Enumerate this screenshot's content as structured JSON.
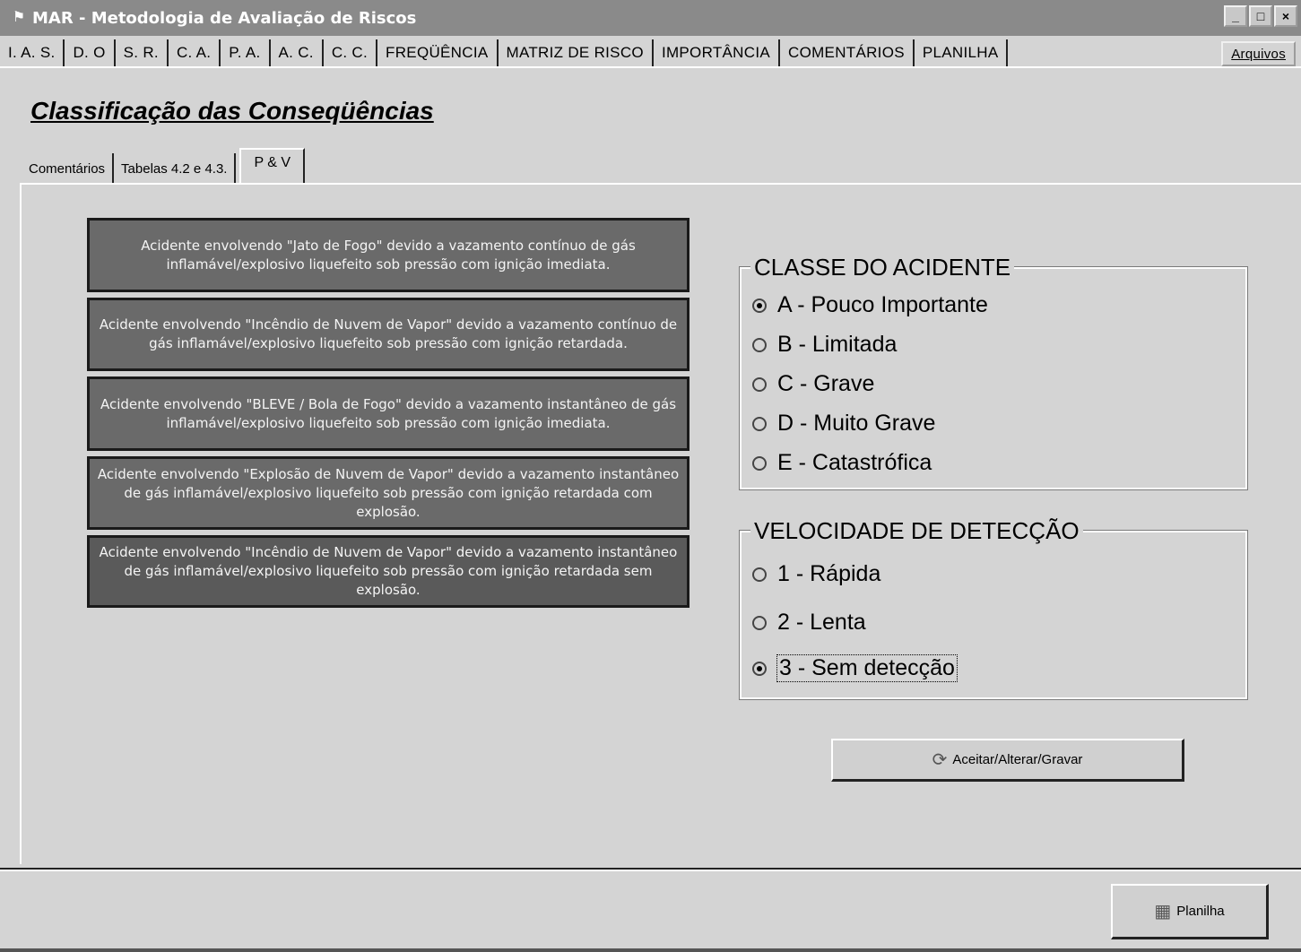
{
  "window": {
    "title": "MAR - Metodologia de Avaliação de Riscos",
    "controls": [
      "_",
      "□",
      "×"
    ]
  },
  "top_tabs": [
    {
      "label": "I. A. S."
    },
    {
      "label": "D. O"
    },
    {
      "label": "S. R."
    },
    {
      "label": "C. A."
    },
    {
      "label": "P. A."
    },
    {
      "label": "A. C."
    },
    {
      "label": "C. C."
    },
    {
      "label": "FREQÜÊNCIA"
    },
    {
      "label": "MATRIZ DE RISCO"
    },
    {
      "label": "IMPORTÂNCIA"
    },
    {
      "label": "COMENTÁRIOS"
    },
    {
      "label": "PLANILHA"
    }
  ],
  "arquivos_label": "Arquivos",
  "active_top_tab": "C. C.",
  "page_title": "Classificação das Conseqüências",
  "sub_tabs": [
    {
      "label": "Comentários"
    },
    {
      "label": "Tabelas 4.2 e 4.3."
    },
    {
      "label": "P & V"
    }
  ],
  "active_sub_tab": "P & V",
  "accidents": [
    "Acidente envolvendo \"Jato de Fogo\" devido a vazamento contínuo de gás inflamável/explosivo liquefeito sob pressão com ignição imediata.",
    "Acidente envolvendo \"Incêndio de Nuvem de Vapor\" devido a vazamento contínuo de gás inflamável/explosivo liquefeito sob pressão com ignição retardada.",
    "Acidente envolvendo \"BLEVE / Bola de Fogo\" devido a vazamento instantâneo de gás inflamável/explosivo liquefeito sob pressão com ignição imediata.",
    "Acidente envolvendo \"Explosão de Nuvem de Vapor\" devido a vazamento instantâneo de gás inflamável/explosivo liquefeito sob pressão com ignição retardada com explosão.",
    "Acidente envolvendo \"Incêndio de Nuvem de Vapor\" devido a vazamento instantâneo de gás inflamável/explosivo liquefeito sob pressão com ignição retardada sem explosão."
  ],
  "classe": {
    "legend": "CLASSE DO ACIDENTE",
    "options": [
      {
        "label": "A - Pouco Importante",
        "checked": true
      },
      {
        "label": "B - Limitada",
        "checked": false
      },
      {
        "label": "C - Grave",
        "checked": false
      },
      {
        "label": "D - Muito Grave",
        "checked": false
      },
      {
        "label": "E - Catastrófica",
        "checked": false
      }
    ]
  },
  "velocidade": {
    "legend": "VELOCIDADE DE DETECÇÃO",
    "options": [
      {
        "label": "1 - Rápida",
        "checked": false
      },
      {
        "label": "2 - Lenta",
        "checked": false
      },
      {
        "label": "3 - Sem detecção",
        "checked": true
      }
    ]
  },
  "buttons": {
    "accept": "Aceitar/Alterar/Gravar",
    "planilha": "Planilha"
  }
}
